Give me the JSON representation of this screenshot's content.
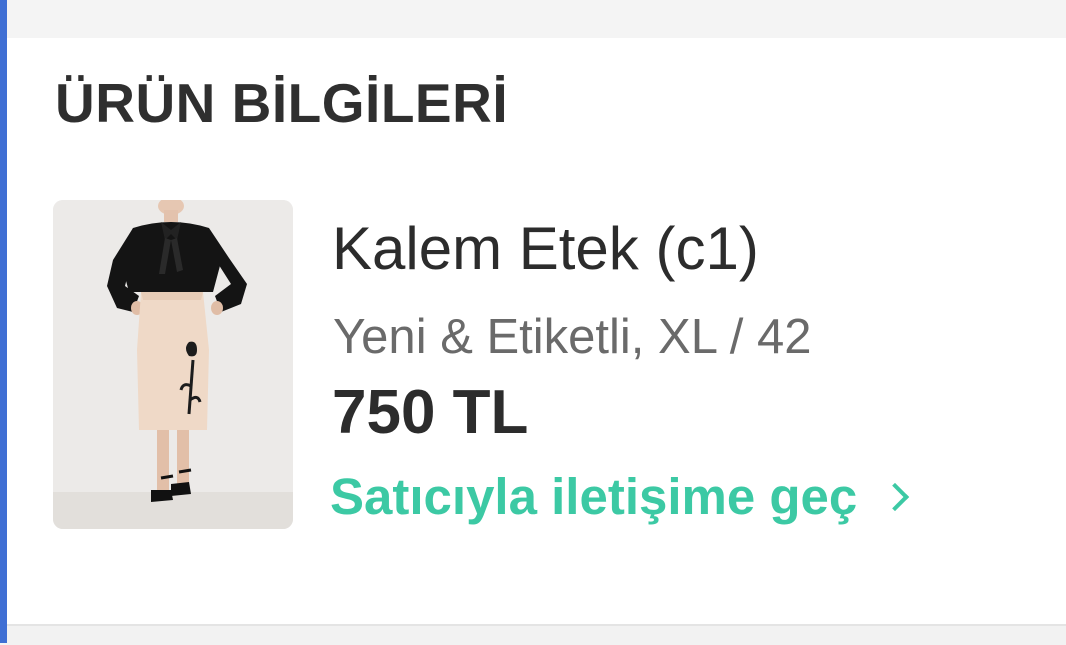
{
  "section": {
    "title": "ÜRÜN BİLGİLERİ"
  },
  "product": {
    "name": "Kalem Etek (c1)",
    "meta": "Yeni & Etiketli, XL / 42",
    "price": "750 TL",
    "image": "product-photo"
  },
  "contact": {
    "label": "Satıcıyla iletişime geç",
    "icon": "chevron-right-icon"
  },
  "colors": {
    "accent": "#3cc9a4",
    "text_primary": "#2c2c2c",
    "text_secondary": "#6a6a6a",
    "edge": "#3f6fd4"
  }
}
